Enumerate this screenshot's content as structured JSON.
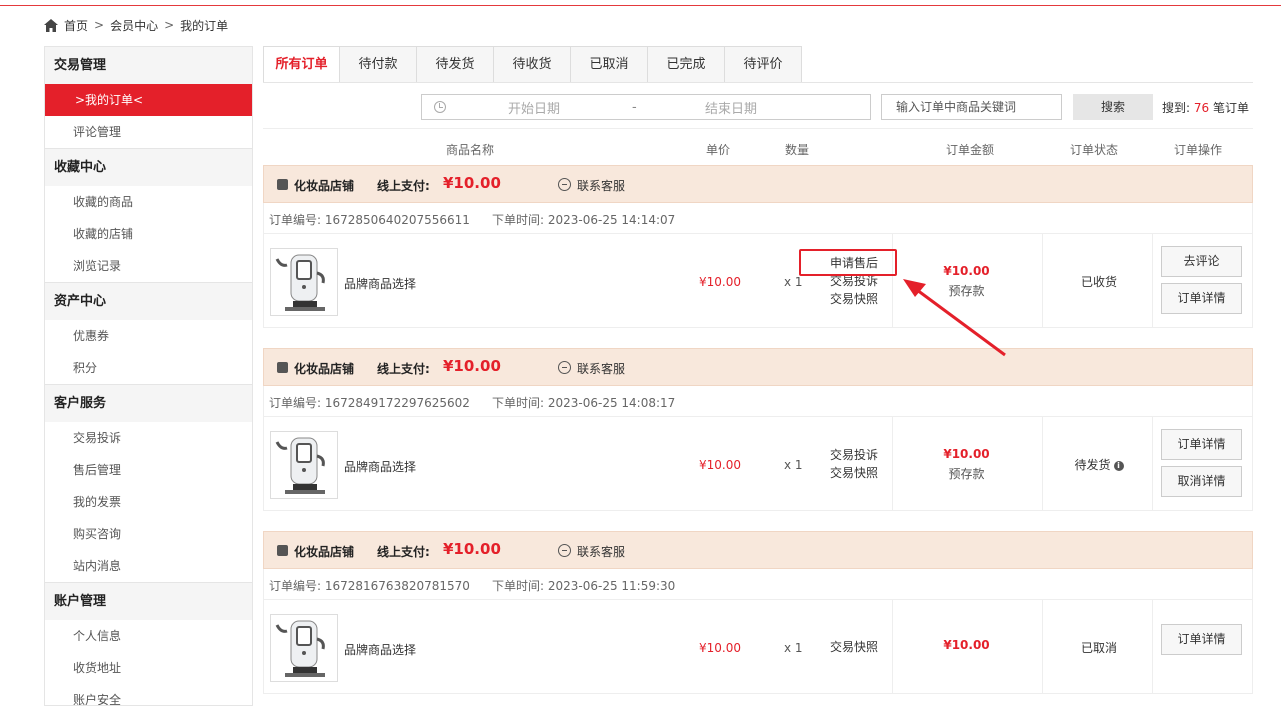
{
  "breadcrumb": {
    "home": "首页",
    "sep": ">",
    "member": "会员中心",
    "current": "我的订单"
  },
  "sidebar": {
    "groups": [
      {
        "title": "交易管理",
        "items": [
          {
            "label": ">我的订单<",
            "active": true
          },
          {
            "label": "评论管理"
          }
        ]
      },
      {
        "title": "收藏中心",
        "items": [
          {
            "label": "收藏的商品"
          },
          {
            "label": "收藏的店铺"
          },
          {
            "label": "浏览记录"
          }
        ]
      },
      {
        "title": "资产中心",
        "items": [
          {
            "label": "优惠券"
          },
          {
            "label": "积分"
          }
        ]
      },
      {
        "title": "客户服务",
        "items": [
          {
            "label": "交易投诉"
          },
          {
            "label": "售后管理"
          },
          {
            "label": "我的发票"
          },
          {
            "label": "购买咨询"
          },
          {
            "label": "站内消息"
          }
        ]
      },
      {
        "title": "账户管理",
        "items": [
          {
            "label": "个人信息"
          },
          {
            "label": "收货地址"
          },
          {
            "label": "账户安全"
          }
        ]
      }
    ]
  },
  "tabs": [
    "所有订单",
    "待付款",
    "待发货",
    "待收货",
    "已取消",
    "已完成",
    "待评价"
  ],
  "active_tab": "所有订单",
  "search": {
    "start_placeholder": "开始日期",
    "dash": "-",
    "end_placeholder": "结束日期",
    "keyword_placeholder": "输入订单中商品关键词",
    "button": "搜索",
    "result_prefix": "搜到:",
    "result_count": "76",
    "result_suffix": "笔订单"
  },
  "columns": {
    "name": "商品名称",
    "price": "单价",
    "qty": "数量",
    "amount": "订单金额",
    "status": "订单状态",
    "ops": "订单操作"
  },
  "orders": [
    {
      "shop": "化妆品店铺",
      "pay_label": "线上支付:",
      "pay_amount": "¥10.00",
      "cs": "联系客服",
      "no": "订单编号: 1672850640207556611",
      "time": "下单时间: 2023-06-25 14:14:07",
      "product": "品牌商品选择",
      "unit_price": "¥10.00",
      "qty": "x 1",
      "actions": [
        "申请售后",
        "交易投诉",
        "交易快照"
      ],
      "total": "¥10.00",
      "deposit": "预存款",
      "status": "已收货",
      "buttons": [
        "去评论",
        "订单详情"
      ]
    },
    {
      "shop": "化妆品店铺",
      "pay_label": "线上支付:",
      "pay_amount": "¥10.00",
      "cs": "联系客服",
      "no": "订单编号: 1672849172297625602",
      "time": "下单时间: 2023-06-25 14:08:17",
      "product": "品牌商品选择",
      "unit_price": "¥10.00",
      "qty": "x 1",
      "actions": [
        "交易投诉",
        "交易快照"
      ],
      "total": "¥10.00",
      "deposit": "预存款",
      "status": "待发货",
      "buttons": [
        "订单详情",
        "取消详情"
      ]
    },
    {
      "shop": "化妆品店铺",
      "pay_label": "线上支付:",
      "pay_amount": "¥10.00",
      "cs": "联系客服",
      "no": "订单编号: 1672816763820781570",
      "time": "下单时间: 2023-06-25 11:59:30",
      "product": "品牌商品选择",
      "unit_price": "¥10.00",
      "qty": "x 1",
      "actions": [
        "交易快照"
      ],
      "total": "¥10.00",
      "status": "已取消",
      "buttons": [
        "订单详情"
      ]
    }
  ],
  "colors": {
    "accent": "#e4202a",
    "order_header_bg": "#f8e8dc"
  }
}
